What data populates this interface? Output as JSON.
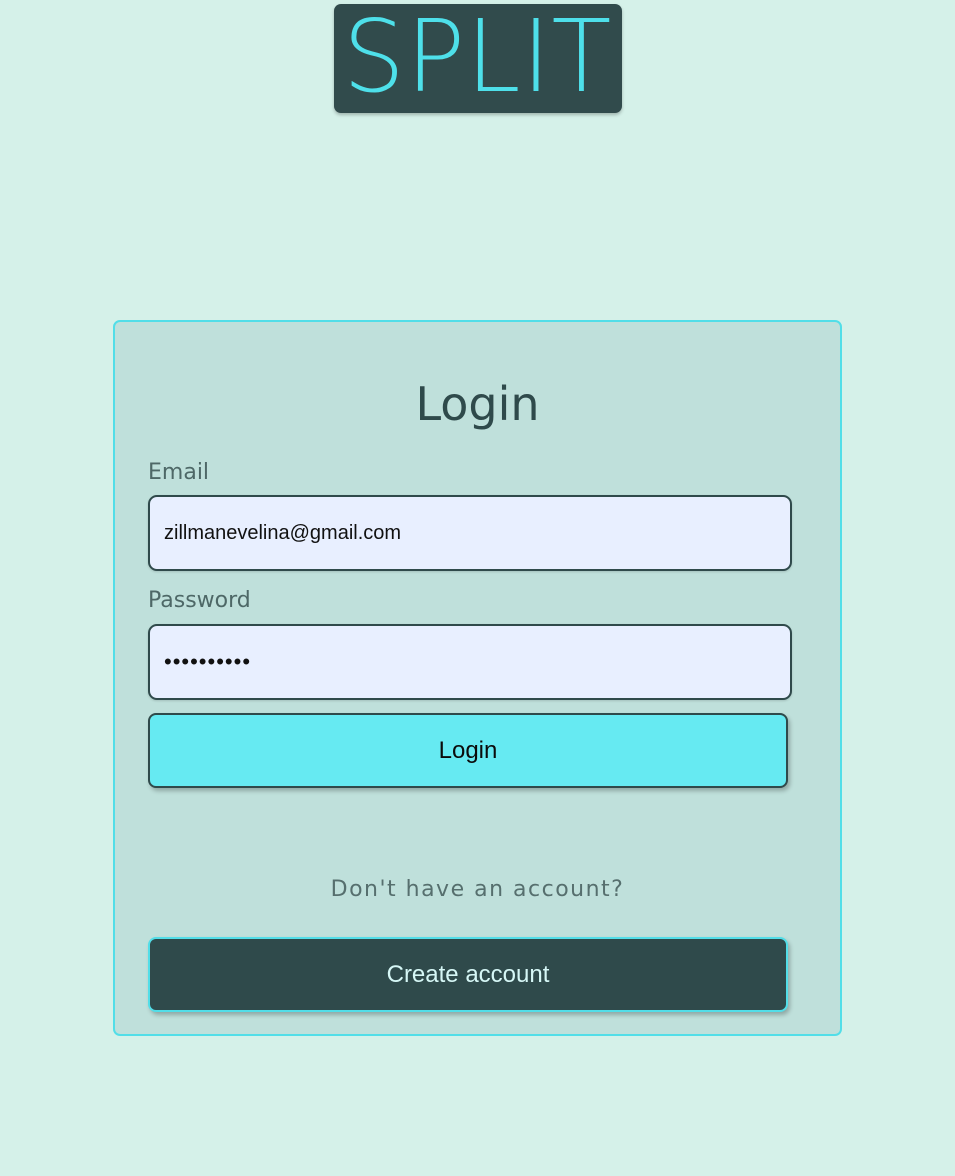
{
  "logo": {
    "text": "SPLIT"
  },
  "login_form": {
    "title": "Login",
    "email": {
      "label": "Email",
      "value": "zillmanevelina@gmail.com"
    },
    "password": {
      "label": "Password",
      "value": "••••••••••"
    },
    "login_button": "Login",
    "signup_prompt": "Don't have an account?",
    "create_account_button": "Create account"
  },
  "colors": {
    "page_background": "#d5f1e9",
    "card_background": "#bfe0db",
    "accent_cyan": "#52dee8",
    "dark_teal": "#2f4a4b",
    "login_button": "#66eaf2"
  }
}
